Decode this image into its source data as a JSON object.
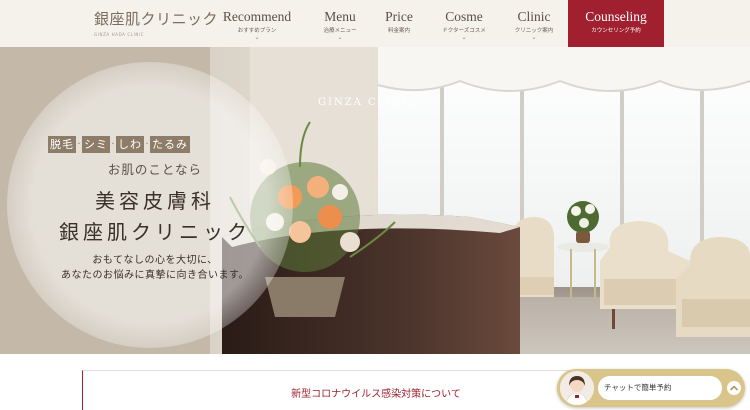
{
  "header": {
    "logo_text": "銀座肌クリニック",
    "logo_subtext": "GINZA HADA CLINIC",
    "nav": [
      {
        "main": "Recommend",
        "sub": "おすすめプラン"
      },
      {
        "main": "Menu",
        "sub": "治療メニュー"
      },
      {
        "main": "Price",
        "sub": "料金案内"
      },
      {
        "main": "Cosme",
        "sub": "ドクターズコスメ"
      },
      {
        "main": "Clinic",
        "sub": "クリニック案内"
      }
    ],
    "cta": {
      "main": "Counseling",
      "sub": "カウンセリング予約"
    }
  },
  "hero": {
    "tags": [
      "脱毛",
      "シミ",
      "しわ",
      "たるみ"
    ],
    "lead": "お肌のことなら",
    "title_line1": "美容皮膚科",
    "title_line2": "銀座肌クリニック",
    "desc_line1": "おもてなしの心を大切に、",
    "desc_line2": "あなたのお悩みに真摯に向き合います。",
    "wall_sign": "GINZA CLINIC"
  },
  "notice": {
    "link_text": "新型コロナウイルス感染対策について"
  },
  "chat": {
    "label": "チャットで簡単予約"
  },
  "colors": {
    "accent_red": "#a0202f",
    "header_bg": "#f5f2ec",
    "tag_bg": "#8d7d68",
    "chat_gold": "#d9c48a"
  },
  "icons": {
    "nav_chevron": "chevron-down-icon",
    "chat_toggle": "chevron-up-icon",
    "chat_avatar": "staff-avatar-icon"
  }
}
